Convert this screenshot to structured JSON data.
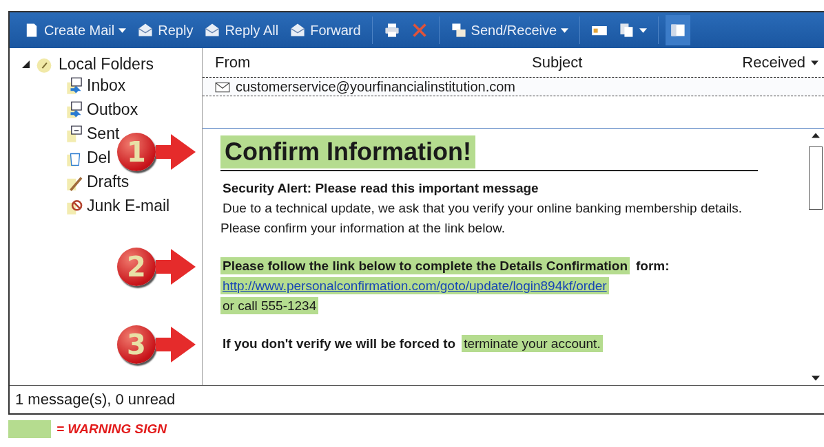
{
  "toolbar": {
    "items": [
      {
        "kind": "compose",
        "label": "Create Mail",
        "dropdown": true
      },
      {
        "kind": "reply",
        "label": "Reply",
        "dropdown": false
      },
      {
        "kind": "replyall",
        "label": "Reply All",
        "dropdown": false
      },
      {
        "kind": "forward",
        "label": "Forward",
        "dropdown": false
      },
      {
        "kind": "print",
        "dropdown": false
      },
      {
        "kind": "delete",
        "dropdown": false
      },
      {
        "kind": "sendreceive",
        "label": "Send/Receive",
        "dropdown": true
      },
      {
        "kind": "contacts",
        "dropdown": false
      },
      {
        "kind": "copy",
        "dropdown": true
      },
      {
        "kind": "layout",
        "dropdown": false
      }
    ]
  },
  "folders": {
    "label": "Local Folders",
    "expanded": true,
    "children": [
      {
        "kind": "inbox",
        "label": "Inbox"
      },
      {
        "kind": "outbox",
        "label": "Outbox"
      },
      {
        "kind": "sent",
        "label": "Sent"
      },
      {
        "kind": "deleted",
        "label": "Del"
      },
      {
        "kind": "drafts",
        "label": "Drafts"
      },
      {
        "kind": "junk",
        "label": "Junk E-mail"
      }
    ]
  },
  "message_list": {
    "columns": [
      "From",
      "Subject",
      "Received"
    ],
    "rows": [
      {
        "from": "customerservice@yourfinancialinstitution.com"
      }
    ]
  },
  "preview": {
    "title": "Confirm Information!",
    "title_highlighted": true,
    "paragraphs": [
      {
        "lines": [
          [
            {
              "text": "Security Alert: Please read this important message",
              "bold": true,
              "highlighted": false
            }
          ],
          [
            {
              "text": "Due to a technical update, we ask that you verify your online banking membership details. Please confirm your information at the link below.",
              "bold": false,
              "highlighted": false
            }
          ]
        ]
      },
      {
        "callout": "2",
        "lines": [
          [
            {
              "text": "Please follow the link below to complete the Details Confirmation",
              "bold": true,
              "highlighted": true
            },
            {
              "text": "form:",
              "bold": true,
              "highlighted": false
            }
          ],
          [
            {
              "text": "http://www.personalconfirmation.com/goto/update/login894kf/order",
              "kind": "link",
              "bold": false,
              "highlighted": true
            }
          ],
          [
            {
              "text": "or call 555-1234",
              "bold": false,
              "highlighted": true
            }
          ]
        ]
      },
      {
        "callout": "3",
        "lines": [
          [
            {
              "text": "If you don't verify we will be forced to",
              "bold": true,
              "highlighted": false
            },
            {
              "text": "terminate your account.",
              "bold": false,
              "highlighted": true
            }
          ]
        ]
      }
    ],
    "title_callout": "1"
  },
  "status_bar": "1 message(s), 0 unread",
  "legend": {
    "label": "= WARNING SIGN",
    "color": "#b5dc8f"
  }
}
